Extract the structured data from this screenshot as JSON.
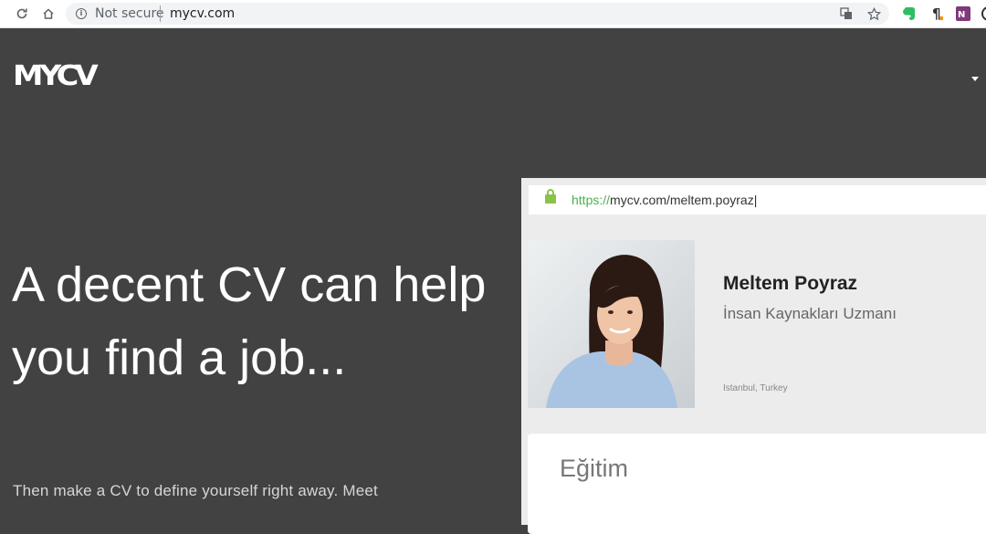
{
  "browser": {
    "security_label": "Not secure",
    "url": "mycv.com"
  },
  "site": {
    "logo": "MYCV",
    "headline": "A decent CV can help you find a job...",
    "subtext": "Then make a CV to define yourself right away. Meet"
  },
  "mockup": {
    "url_scheme": "https://",
    "url_rest": "mycv.com/meltem.poyraz|",
    "profile": {
      "name": "Meltem Poyraz",
      "title": "İnsan Kaynakları Uzmanı",
      "location": "Istanbul, Turkey"
    },
    "section_title": "Eğitim"
  },
  "colors": {
    "page_bg": "#424242",
    "secure_green": "#4caf50"
  }
}
